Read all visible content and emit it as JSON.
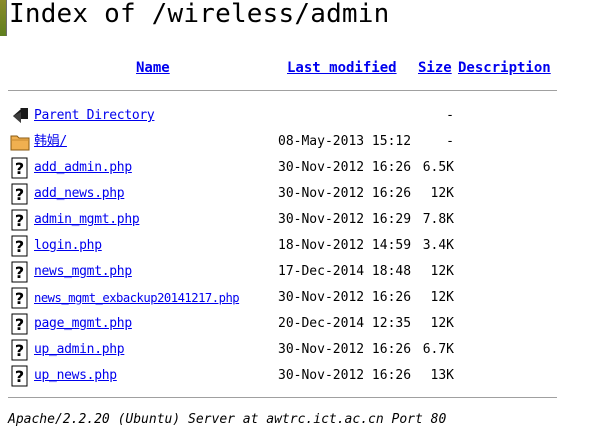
{
  "page": {
    "title": "Index of /wireless/admin"
  },
  "columns": {
    "name": "Name",
    "last_modified": "Last modified",
    "size": "Size",
    "description": "Description"
  },
  "entries": [
    {
      "icon": "back-icon",
      "name": "Parent Directory",
      "modified": "",
      "size": "-"
    },
    {
      "icon": "folder-icon",
      "name": "韩娟/",
      "modified": "08-May-2013 15:12",
      "size": "-"
    },
    {
      "icon": "unknown-file-icon",
      "name": "add_admin.php",
      "modified": "30-Nov-2012 16:26",
      "size": "6.5K"
    },
    {
      "icon": "unknown-file-icon",
      "name": "add_news.php",
      "modified": "30-Nov-2012 16:26",
      "size": "12K"
    },
    {
      "icon": "unknown-file-icon",
      "name": "admin_mgmt.php",
      "modified": "30-Nov-2012 16:29",
      "size": "7.8K"
    },
    {
      "icon": "unknown-file-icon",
      "name": "login.php",
      "modified": "18-Nov-2012 14:59",
      "size": "3.4K"
    },
    {
      "icon": "unknown-file-icon",
      "name": "news_mgmt.php",
      "modified": "17-Dec-2014 18:48",
      "size": "12K"
    },
    {
      "icon": "unknown-file-icon",
      "name": "news_mgmt_exbackup20141217.php",
      "modified": "30-Nov-2012 16:26",
      "size": "12K"
    },
    {
      "icon": "unknown-file-icon",
      "name": "page_mgmt.php",
      "modified": "20-Dec-2014 12:35",
      "size": "12K"
    },
    {
      "icon": "unknown-file-icon",
      "name": "up_admin.php",
      "modified": "30-Nov-2012 16:26",
      "size": "6.7K"
    },
    {
      "icon": "unknown-file-icon",
      "name": "up_news.php",
      "modified": "30-Nov-2012 16:26",
      "size": "13K"
    }
  ],
  "footer": {
    "server_signature": "Apache/2.2.20 (Ubuntu) Server at awtrc.ict.ac.cn Port 80"
  },
  "colors": {
    "link": "#0000ee",
    "folder": "#f0b050",
    "rule": "#a0a0a0"
  }
}
